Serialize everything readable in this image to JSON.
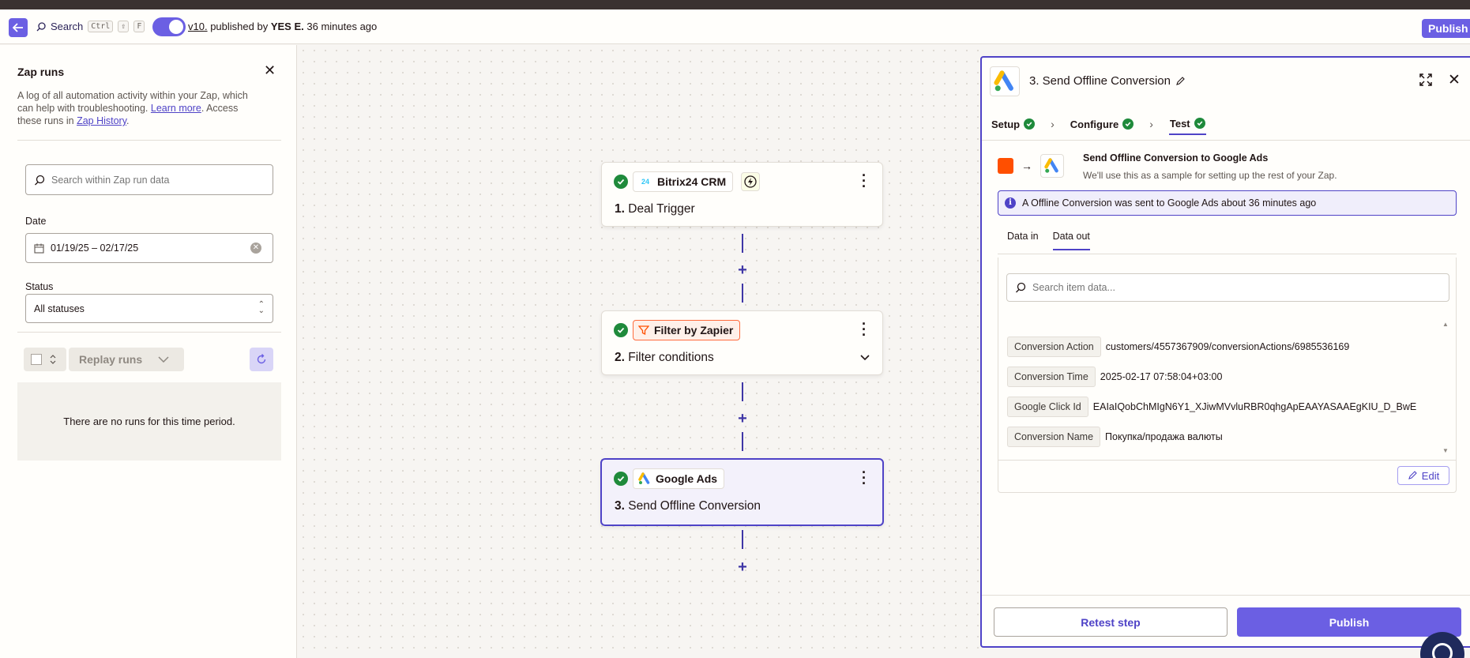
{
  "header": {
    "search_label": "Search",
    "shortcut_keys": [
      "Ctrl",
      "⇧",
      "F"
    ],
    "version_link": "v10.",
    "published_by_text": "published by",
    "author": "YES E.",
    "time_ago": "36 minutes ago",
    "publish_label": "Publish",
    "accent_color": "#6b5fe3"
  },
  "left_panel": {
    "title": "Zap runs",
    "description_prefix": "A log of all automation activity within your Zap, which can help with troubleshooting.",
    "learn_more": "Learn more",
    "description_mid": ". Access these runs in",
    "zap_history": "Zap History",
    "description_suffix": ".",
    "search_placeholder": "Search within Zap run data",
    "date_label": "Date",
    "date_value": "01/19/25 – 02/17/25",
    "status_label": "Status",
    "status_value": "All statuses",
    "replay_label": "Replay runs",
    "empty_message": "There are no runs for this time period."
  },
  "canvas": {
    "steps": [
      {
        "app": "Bitrix24 CRM",
        "number": "1.",
        "title": "Deal Trigger",
        "status": "success"
      },
      {
        "app": "Filter by Zapier",
        "number": "2.",
        "title": "Filter conditions",
        "status": "success"
      },
      {
        "app": "Google Ads",
        "number": "3.",
        "title": "Send Offline Conversion",
        "status": "success",
        "selected": true
      }
    ]
  },
  "right_panel": {
    "title": "3. Send Offline Conversion",
    "tabs": [
      {
        "label": "Setup",
        "status": "complete"
      },
      {
        "label": "Configure",
        "status": "complete"
      },
      {
        "label": "Test",
        "status": "complete",
        "active": true
      }
    ],
    "flow_title": "Send Offline Conversion to Google Ads",
    "flow_subtitle": "We'll use this as a sample for setting up the rest of your Zap.",
    "info_message": "A Offline Conversion was sent to Google Ads about 36 minutes ago",
    "data_tabs": [
      {
        "label": "Data in",
        "active": false
      },
      {
        "label": "Data out",
        "active": true
      }
    ],
    "data_search_placeholder": "Search item data...",
    "data_fields": [
      {
        "key": "Conversion Action",
        "value": "customers/4557367909/conversionActions/6985536169"
      },
      {
        "key": "Conversion Time",
        "value": "2025-02-17 07:58:04+03:00"
      },
      {
        "key": "Google Click Id",
        "value": "EAIaIQobChMIgN6Y1_XJiwMVvluRBR0qhgApEAAYASAAEgKIU_D_BwE"
      },
      {
        "key": "Conversion Name",
        "value": "Покупка/продажа валюты"
      }
    ],
    "edit_label": "Edit",
    "retest_label": "Retest step",
    "publish_label": "Publish"
  }
}
